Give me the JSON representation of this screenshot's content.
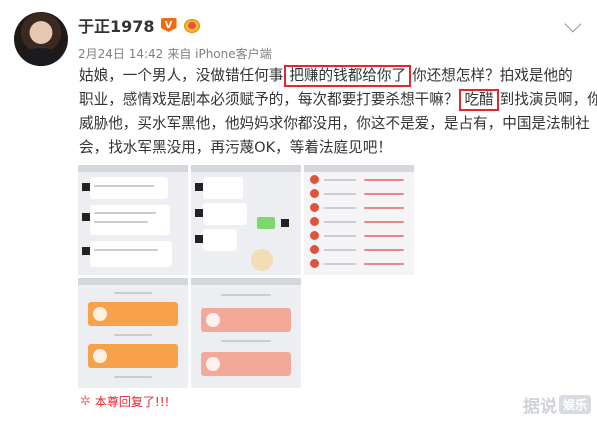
{
  "post": {
    "username": "于正1978",
    "vip_badge": "V",
    "date": "2月24日 14:42",
    "source": "来自 iPhone客户端",
    "lines": {
      "l1_a": "姑娘，一个男人，没做错任何事",
      "l1_hl": "把赚的钱都给你了",
      "l1_b": "你还想怎样？拍戏是他的",
      "l2_a": "职业，感情戏是剧本必须赋予的，每次都要打要杀想干嘛？",
      "l2_hl": "吃醋",
      "l2_b": "到找演员啊，你",
      "l3": "威胁他，买水军黑他，他妈妈求你都没用，你这不是爱，是占有，中国是法制社",
      "l4": "会，找水军黑没用，再污蔑OK，等着法庭见吧！"
    }
  },
  "footer": {
    "reply_label": "本尊回复了!!!"
  },
  "watermark": {
    "text": "据说",
    "tag": "娱乐"
  },
  "colors": {
    "highlight_border": "#e8252a",
    "vip_badge": "#f36b10",
    "reply_text": "#e8252a"
  }
}
